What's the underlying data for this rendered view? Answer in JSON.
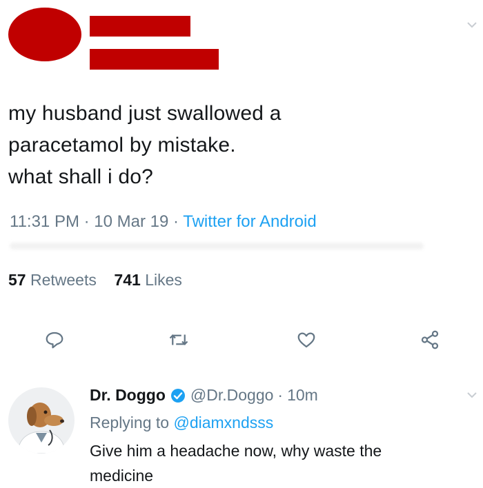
{
  "tweet": {
    "text_lines": [
      "my husband just swallowed a",
      "paracetamol by mistake.",
      "what shall i do?"
    ],
    "time": "11:31 PM",
    "date": "10 Mar 19",
    "separator": "·",
    "source": "Twitter for Android",
    "retweets_count": "57",
    "retweets_label": "Retweets",
    "likes_count": "741",
    "likes_label": "Likes"
  },
  "actions": [
    {
      "name": "reply-icon"
    },
    {
      "name": "retweet-icon"
    },
    {
      "name": "like-icon"
    },
    {
      "name": "share-icon"
    }
  ],
  "reply": {
    "name": "Dr. Doggo",
    "handle": "@Dr.Doggo",
    "separator": "·",
    "time": "10m",
    "replying_label": "Replying to",
    "replying_to": "@diamxndsss",
    "text_lines": [
      "Give him a headache now, why waste the",
      "medicine"
    ]
  },
  "colors": {
    "accent": "#1da1f2",
    "redaction": "#c00000",
    "muted": "#657786",
    "text": "#14171a"
  }
}
